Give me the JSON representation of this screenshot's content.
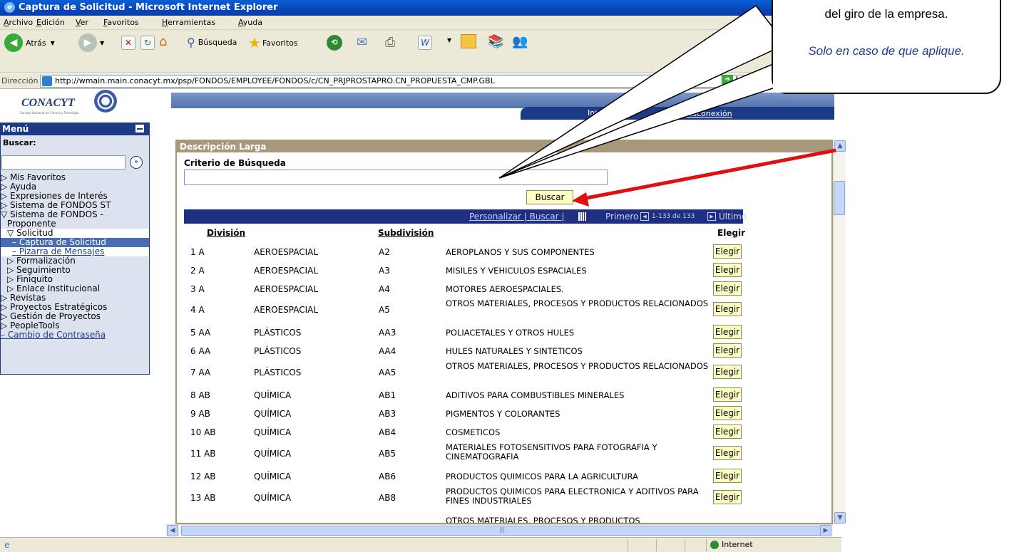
{
  "window": {
    "title": "Captura de Solicitud - Microsoft Internet Explorer"
  },
  "menubar": [
    "Archivo",
    "Edición",
    "Ver",
    "Favoritos",
    "Herramientas",
    "Ayuda"
  ],
  "toolbar": {
    "back": "Atrás",
    "search": "Búsqueda",
    "favorites": "Favoritos"
  },
  "address": {
    "label": "Dirección",
    "url": "http://wmain.main.conacyt.mx/psp/FONDOS/EMPLOYEE/FONDOS/c/CN_PRJPROSTAPRO.CN_PROPUESTA_CMP.GBL",
    "go": "Ir"
  },
  "header": {
    "logo": "CONACYT",
    "logo_sub": "Consejo Nacional de Ciencia y Tecnología",
    "home": "Inicio",
    "logout": "Desconexión"
  },
  "sidebar": {
    "title": "Menú",
    "search_label": "Buscar:",
    "items": [
      "▷ Mis Favoritos",
      "▷ Ayuda",
      "▷ Expresiones de Interés",
      "▷ Sistema de FONDOS ST",
      "▽ Sistema de FONDOS -",
      "Proponente",
      "▽ Solicitud",
      "– Captura de Solicitud",
      "– Pizarra de Mensajes",
      "▷ Formalización",
      "▷ Seguimiento",
      "▷ Finiquito",
      "▷ Enlace Institucional",
      "▷ Revistas",
      "▷ Proyectos Estratégicos",
      "▷ Gestión de Proyectos",
      "▷ PeopleTools",
      "– Cambio de Contraseña"
    ]
  },
  "panel": {
    "title": "Descripción Larga",
    "criteria_label": "Criterio de Búsqueda",
    "search_button": "Buscar",
    "grid_links": "Personalizar | Buscar |",
    "grid_nav_first": "Primero",
    "grid_range": "1-133 de 133",
    "grid_nav_last": "Último",
    "col_division": "División",
    "col_subdivision": "Subdivisión",
    "col_choose": "Elegir",
    "choose_label": "Elegir",
    "rows": [
      {
        "n": "1 A",
        "div": "AEROESPACIAL",
        "code": "A2",
        "name": "AEROPLANOS Y SUS COMPONENTES"
      },
      {
        "n": "2 A",
        "div": "AEROESPACIAL",
        "code": "A3",
        "name": "MISILES Y VEHICULOS ESPACIALES"
      },
      {
        "n": "3 A",
        "div": "AEROESPACIAL",
        "code": "A4",
        "name": "MOTORES AEROESPACIALES."
      },
      {
        "n": "4 A",
        "div": "AEROESPACIAL",
        "code": "A5",
        "name": "OTROS MATERIALES, PROCESOS Y PRODUCTOS RELACIONADOS"
      },
      {
        "n": "5 AA",
        "div": "PLÁSTICOS",
        "code": "AA3",
        "name": "POLIACETALES Y OTROS HULES"
      },
      {
        "n": "6 AA",
        "div": "PLÁSTICOS",
        "code": "AA4",
        "name": "HULES NATURALES Y SINTETICOS"
      },
      {
        "n": "7 AA",
        "div": "PLÁSTICOS",
        "code": "AA5",
        "name": "OTROS MATERIALES, PROCESOS Y PRODUCTOS RELACIONADOS"
      },
      {
        "n": "8 AB",
        "div": "QUÍMICA",
        "code": "AB1",
        "name": "ADITIVOS PARA COMBUSTIBLES MINERALES"
      },
      {
        "n": "9 AB",
        "div": "QUÍMICA",
        "code": "AB3",
        "name": "PIGMENTOS Y COLORANTES"
      },
      {
        "n": "10 AB",
        "div": "QUÍMICA",
        "code": "AB4",
        "name": "COSMETICOS"
      },
      {
        "n": "11 AB",
        "div": "QUÍMICA",
        "code": "AB5",
        "name": "MATERIALES FOTOSENSITIVOS PARA FOTOGRAFIA Y CINEMATOGRAFIA"
      },
      {
        "n": "12 AB",
        "div": "QUÍMICA",
        "code": "AB6",
        "name": "PRODUCTOS QUIMICOS PARA LA AGRICULTURA"
      },
      {
        "n": "13 AB",
        "div": "QUÍMICA",
        "code": "AB8",
        "name": "PRODUCTOS QUIMICOS PARA ELECTRONICA Y ADITIVOS PARA FINES INDUSTRIALES"
      },
      {
        "n": "",
        "div": "",
        "code": "",
        "name": "OTROS MATERIALES, PROCESOS Y PRODUCTOS"
      }
    ]
  },
  "status": {
    "zone": "Internet"
  },
  "callout": {
    "line1": "del giro de la empresa.",
    "line2": "Solo en caso de que aplique."
  }
}
